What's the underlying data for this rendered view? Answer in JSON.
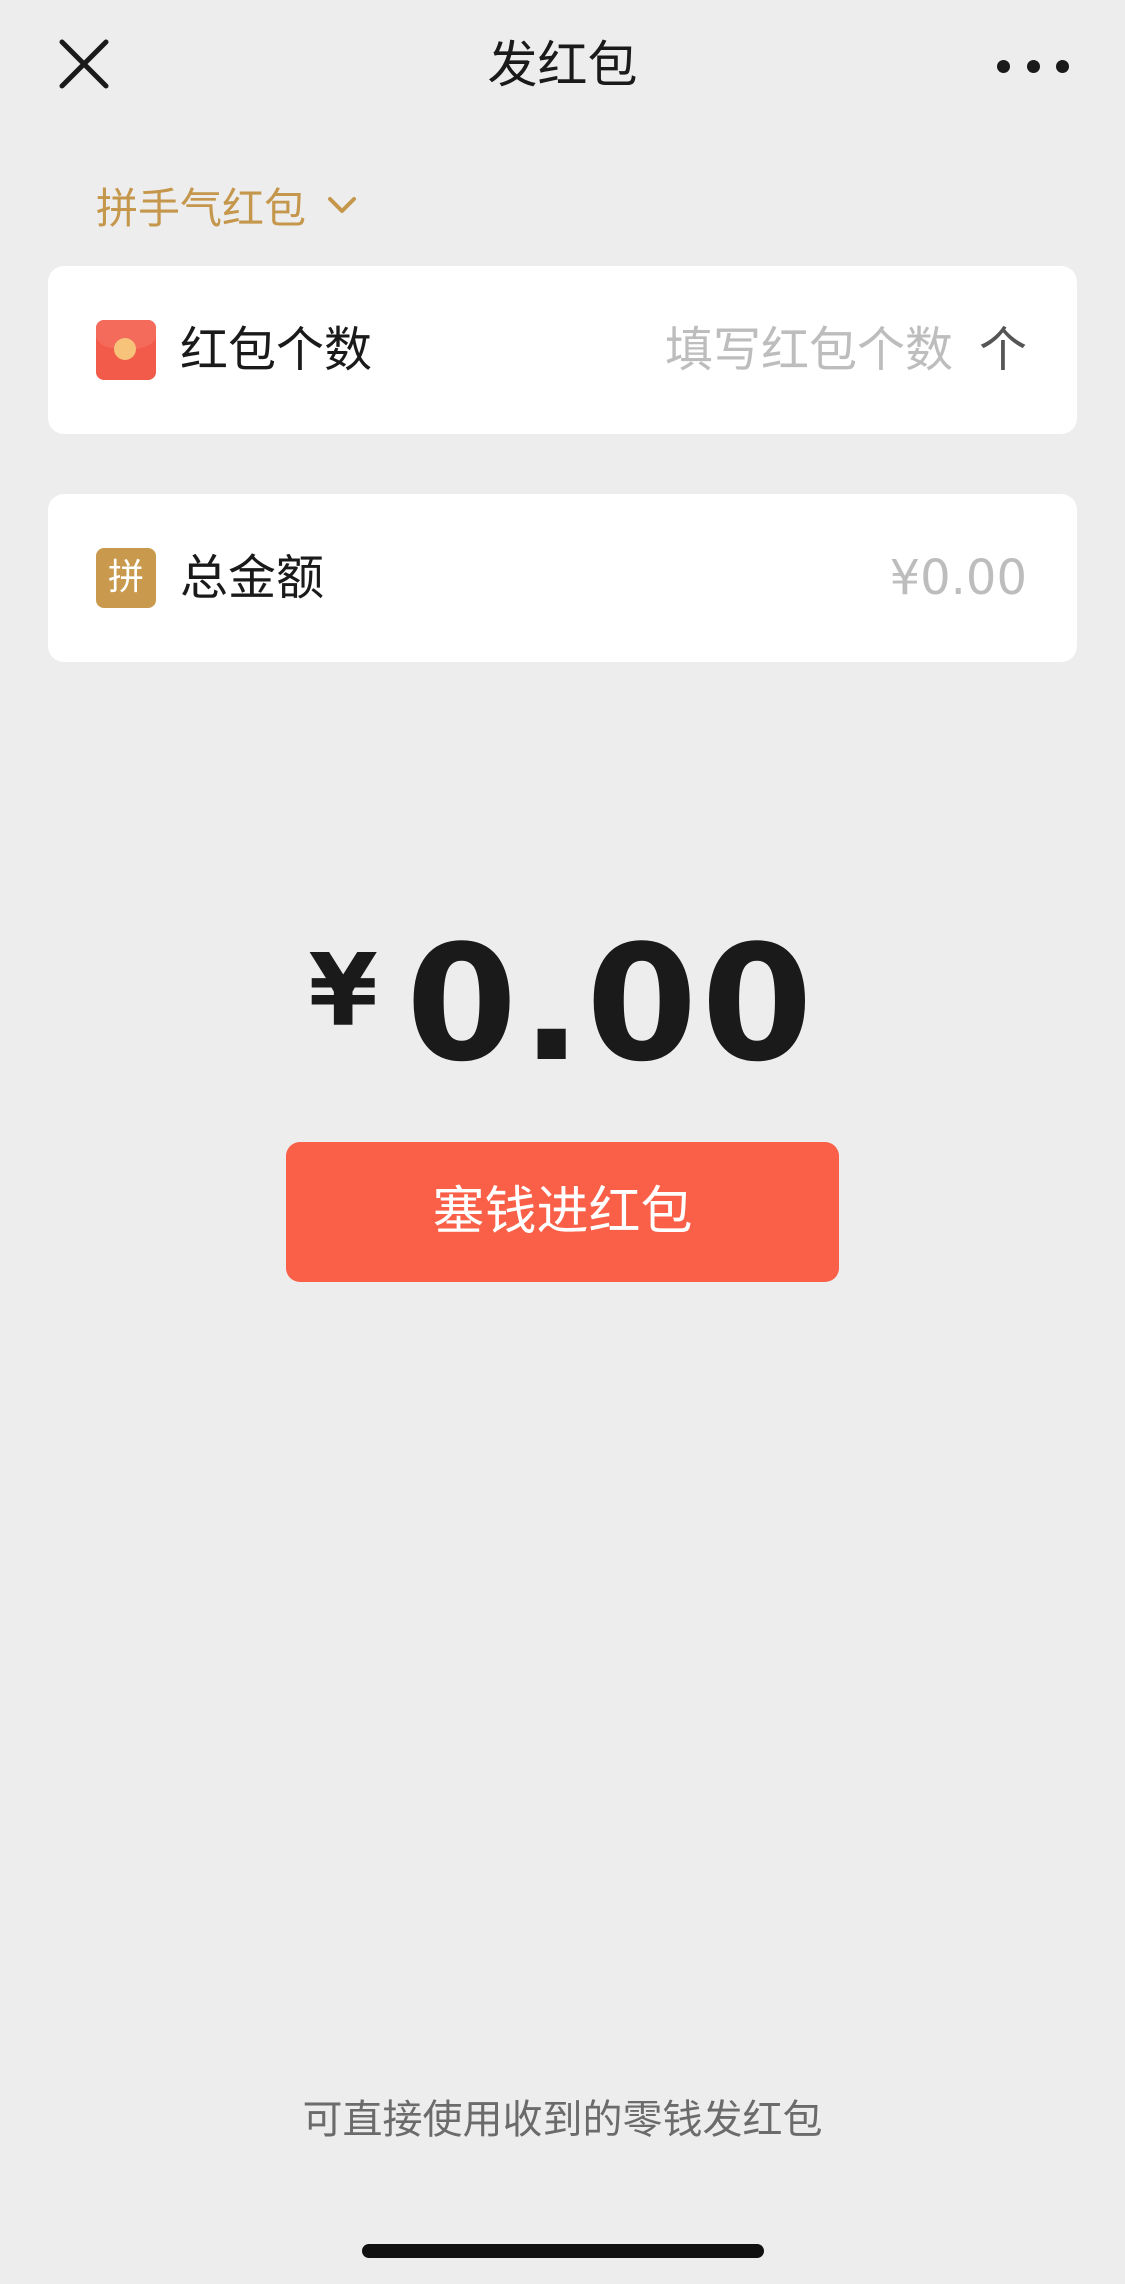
{
  "nav": {
    "title": "发红包",
    "close_icon": "close-icon",
    "more_icon": "more-icon"
  },
  "packet_type": {
    "label": "拼手气红包",
    "icon": "chevron-down-icon",
    "color": "#c5974c"
  },
  "count_field": {
    "icon": "red-packet-icon",
    "label": "红包个数",
    "placeholder": "填写红包个数",
    "unit": "个"
  },
  "amount_field": {
    "icon_text": "拼",
    "label": "总金额",
    "placeholder": "¥0.00"
  },
  "total": {
    "currency": "¥",
    "amount": "0.00"
  },
  "submit_button": {
    "label": "塞钱进红包",
    "color": "#fa5f47"
  },
  "footer": {
    "hint": "可直接使用收到的零钱发红包"
  }
}
